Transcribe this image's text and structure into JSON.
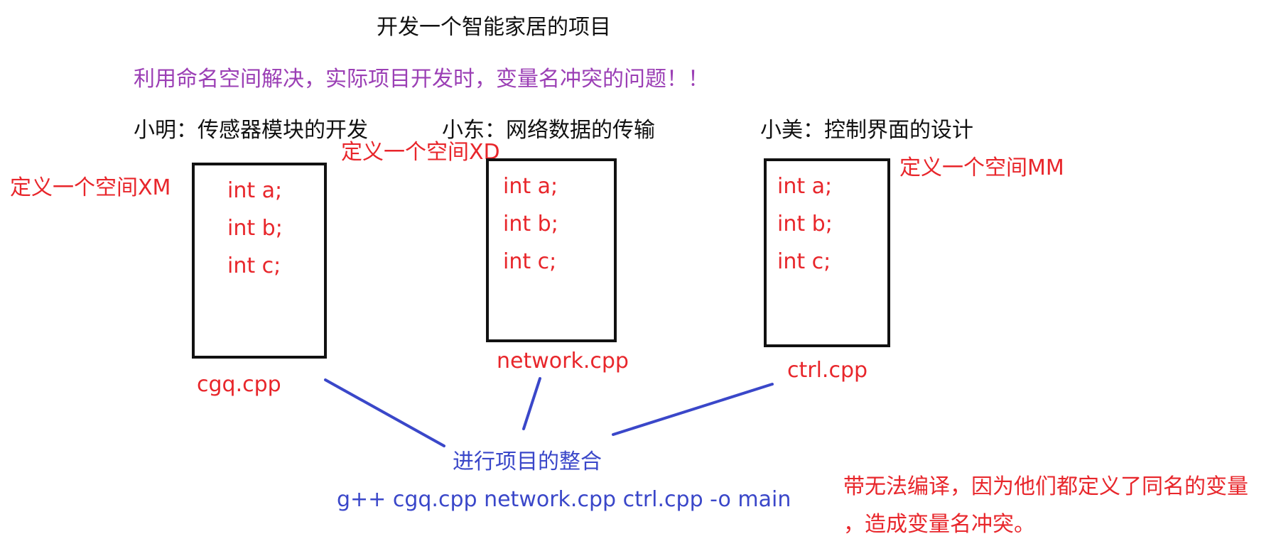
{
  "title": "开发一个智能家居的项目",
  "subtitle": "利用命名空间解决，实际项目开发时，变量名冲突的问题！！",
  "modules": [
    {
      "developer": "小明：传感器模块的开发",
      "namespace_label": "定义一个空间XM",
      "code": [
        "int a;",
        "int b;",
        "int c;"
      ],
      "file": "cgq.cpp"
    },
    {
      "developer": "小东：网络数据的传输",
      "namespace_label": "定义一个空间XD",
      "code": [
        "int a;",
        "int b;",
        "int c;"
      ],
      "file": "network.cpp"
    },
    {
      "developer": "小美：控制界面的设计",
      "namespace_label": "定义一个空间MM",
      "code": [
        "int a;",
        "int b;",
        "int c;"
      ],
      "file": "ctrl.cpp"
    }
  ],
  "merge": {
    "label": "进行项目的整合",
    "command": "g++  cgq.cpp   network.cpp   ctrl.cpp   -o main"
  },
  "note": {
    "line1": "带无法编译，因为他们都定义了同名的变量",
    "line2": "，造成变量名冲突。"
  },
  "colors": {
    "black": "#111111",
    "purple": "#9b3fb5",
    "red": "#e8262b",
    "blue": "#3a47c9"
  }
}
